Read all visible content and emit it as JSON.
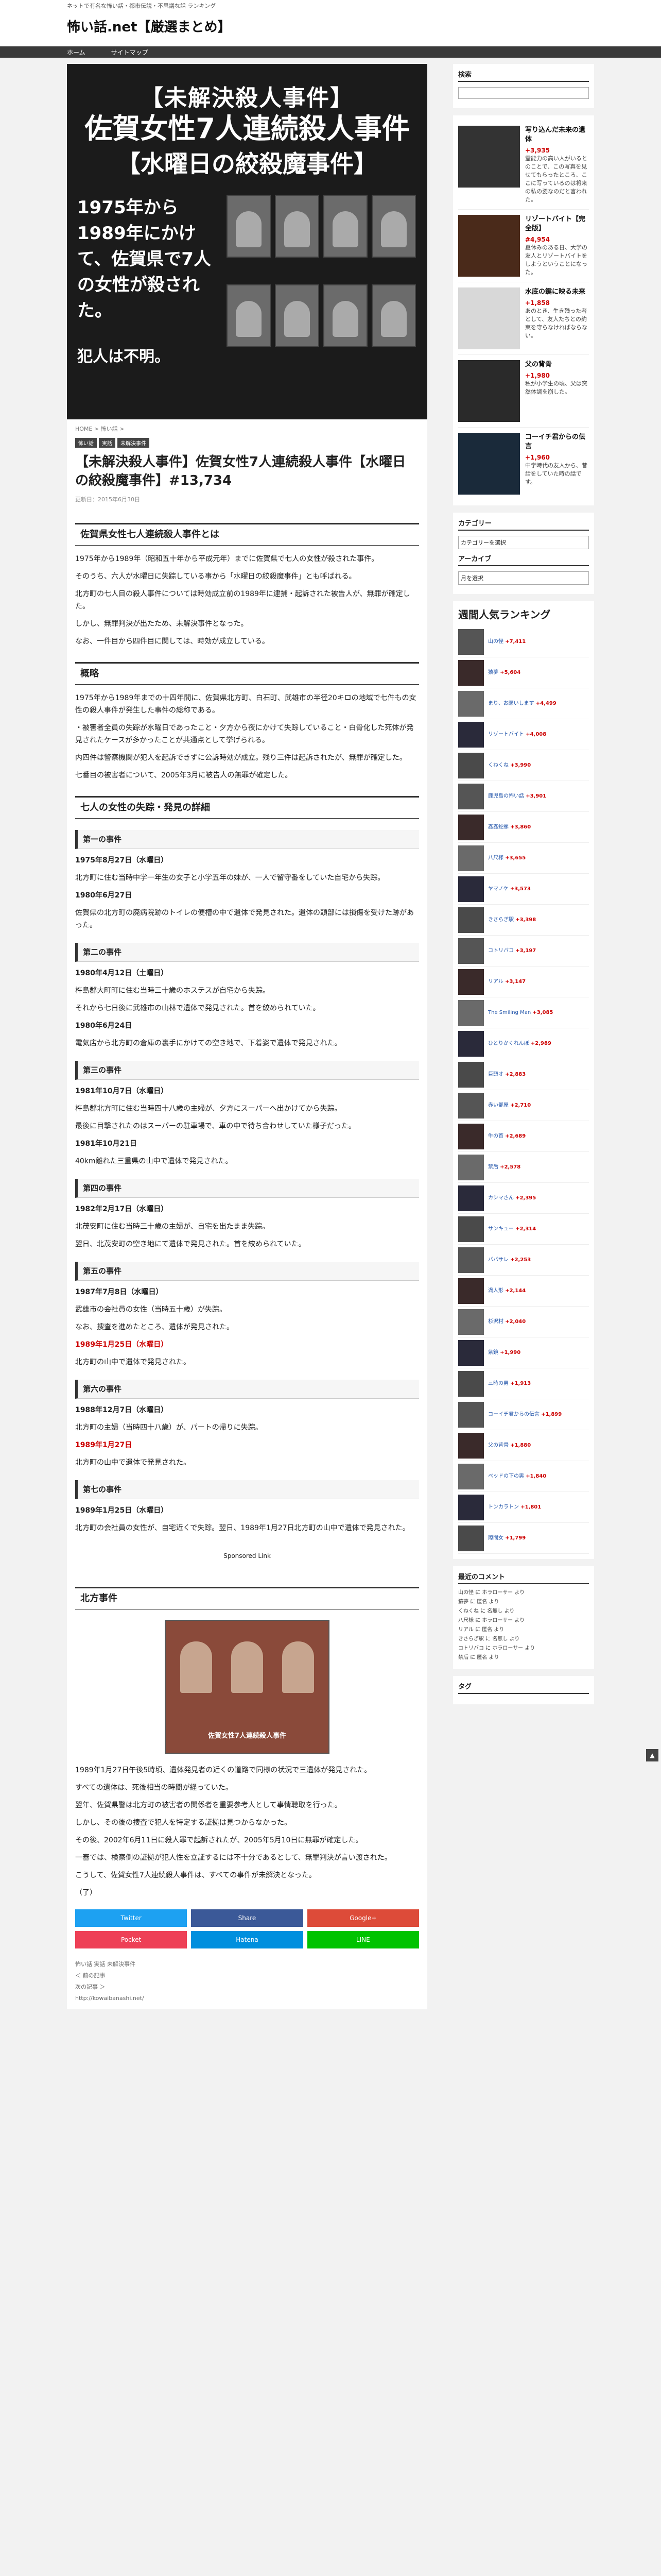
{
  "site": {
    "tagline": "ネットで有名な怖い話・都市伝説・不思議な話 ランキング",
    "title": "怖い話.net【厳選まとめ】"
  },
  "nav": {
    "home": "ホーム",
    "sitemap": "サイトマップ"
  },
  "hero": {
    "line1": "【未解決殺人事件】",
    "line2": "佐賀女性7人連続殺人事件",
    "line3": "【水曜日の絞殺魔事件】",
    "text1": "1975年から1989年にかけて、佐賀県で7人の女性が殺された。",
    "text2": "犯人は不明。"
  },
  "breadcrumb": "HOME > 怖い話 >",
  "tags": [
    "怖い話",
    "実話",
    "未解決事件"
  ],
  "post": {
    "title": "【未解決殺人事件】佐賀女性7人連続殺人事件【水曜日の絞殺魔事件】#13,734",
    "date": "更新日：2015年6月30日"
  },
  "sections": {
    "s1": "佐賀県女性七人連続殺人事件とは",
    "s1p1": "1975年から1989年（昭和五十年から平成元年）までに佐賀県で七人の女性が殺された事件。",
    "s1p2": "そのうち、六人が水曜日に失踪している事から「水曜日の絞殺魔事件」とも呼ばれる。",
    "s1p3": "北方町の七人目の殺人事件については時効成立前の1989年に逮捕・起訴された被告人が、無罪が確定した。",
    "s1p4": "しかし、無罪判決が出たため、未解決事件となった。",
    "s1p5": "なお、一件目から四件目に関しては、時効が成立している。",
    "s2": "概略",
    "s2p1": "1975年から1989年までの十四年間に、佐賀県北方町、白石町、武雄市の半径20キロの地域で七件もの女性の殺人事件が発生した事件の総称である。",
    "s2p2": "・被害者全員の失踪が水曜日であったこと・夕方から夜にかけて失踪していること・白骨化した死体が発見されたケースが多かったことが共通点として挙げられる。",
    "s2p3": "内四件は警察機関が犯人を起訴できずに公訴時効が成立。残り三件は起訴されたが、無罪が確定した。",
    "s2p4": "七番目の被害者について、2005年3月に被告人の無罪が確定した。",
    "s3": "七人の女性の失踪・発見の詳細",
    "c1": "第一の事件",
    "c1d1": "1975年8月27日（水曜日）",
    "c1p1": "北方町に住む当時中学一年生の女子と小学五年の妹が、一人で留守番をしていた自宅から失踪。",
    "c1d2": "1980年6月27日",
    "c1p2": "佐賀県の北方町の廃病院跡のトイレの便槽の中で遺体で発見された。遺体の頭部には損傷を受けた跡があった。",
    "c2": "第二の事件",
    "c2d1": "1980年4月12日（土曜日）",
    "c2p1": "杵島郡大町町に住む当時三十歳のホステスが自宅から失踪。",
    "c2p2": "それから七日後に武雄市の山林で遺体で発見された。首を絞められていた。",
    "c2d2": "1980年6月24日",
    "c2p3": "電気店から北方町の倉庫の裏手にかけての空き地で、下着姿で遺体で発見された。",
    "c3": "第三の事件",
    "c3d1": "1981年10月7日（水曜日）",
    "c3p1": "杵島郡北方町に住む当時四十八歳の主婦が、夕方にスーパーへ出かけてから失踪。",
    "c3p2": "最後に目撃されたのはスーパーの駐車場で、車の中で待ち合わせしていた様子だった。",
    "c3d2": "1981年10月21日",
    "c3p3": "40km離れた三重県の山中で遺体で発見された。",
    "c4": "第四の事件",
    "c4d1": "1982年2月17日（水曜日）",
    "c4p1": "北茂安町に住む当時三十歳の主婦が、自宅を出たまま失踪。",
    "c4p2": "翌日、北茂安町の空き地にて遺体で発見された。首を絞められていた。",
    "c5": "第五の事件",
    "c5d1": "1987年7月8日（水曜日）",
    "c5p1": "武雄市の会社員の女性（当時五十歳）が失踪。",
    "c5p2": "なお、捜査を進めたところ、遺体が発見された。",
    "c5d2": "1989年1月25日（水曜日）",
    "c5p3": "北方町の山中で遺体で発見された。",
    "c6": "第六の事件",
    "c6d1": "1988年12月7日（水曜日）",
    "c6p1": "北方町の主婦（当時四十八歳）が、パートの帰りに失踪。",
    "c6d2": "1989年1月27日",
    "c6p2": "北方町の山中で遺体で発見された。",
    "c7": "第七の事件",
    "c7d1": "1989年1月25日（水曜日）",
    "c7p1": "北方町の会社員の女性が、自宅近くで失踪。翌日、1989年1月27日北方町の山中で遺体で発見された。",
    "spons": "Sponsored Link",
    "s4": "北方事件",
    "photo_caption": "佐賀女性7人連続殺人事件",
    "s4p1": "1989年1月27日午後5時頃、遺体発見者の近くの道路で同様の状況で三遺体が発見された。",
    "s4p2": "すべての遺体は、死後相当の時間が経っていた。",
    "s4p3": "翌年、佐賀県警は北方町の被害者の関係者を重要参考人として事情聴取を行った。",
    "s4p4": "しかし、その後の捜査で犯人を特定する証拠は見つからなかった。",
    "s4p5": "その後、2002年6月11日に殺人罪で起訴されたが、2005年5月10日に無罪が確定した。",
    "s4p6": "一審では、検察側の証拠が犯人性を立証するには不十分であるとして、無罪判決が言い渡された。",
    "s4p7": "こうして、佐賀女性7人連続殺人事件は、すべての事件が未解決となった。",
    "s4p8": "（了）"
  },
  "share": {
    "twitter": "Twitter",
    "facebook": "Share",
    "google": "Google+",
    "pocket": "Pocket",
    "hatena": "Hatena",
    "line": "LINE"
  },
  "foot": {
    "cat": "怖い話 実話 未解決事件",
    "prev": "＜ 前の記事",
    "next": "次の記事 ＞",
    "url": "http://kowaibanashi.net/"
  },
  "sidebar": {
    "search": "検索",
    "articles": [
      {
        "title": "写り込んだ未来の遺体",
        "count": "+3,935",
        "desc": "霊能力の高い人がいるとのことで、この写真を見せてもらったところ、ここに写っているのは将来の私の姿なのだと言われた。"
      },
      {
        "title": "リゾートバイト【完全版】",
        "count": "#4,954",
        "desc": "夏休みのある日、大学の友人とリゾートバイトをしようということになった。"
      },
      {
        "title": "水底の鍵に映る未来",
        "count": "+1,858",
        "desc": "あのとき、生き残った者として、友人たちとの約束を守らなければならない。"
      },
      {
        "title": "父の背骨",
        "count": "+1,980",
        "desc": "私が小学生の頃、父は突然体調を崩した。"
      },
      {
        "title": "コーイチ君からの伝言",
        "count": "+1,960",
        "desc": "中学時代の友人から、昔話をしていた時の話です。"
      }
    ],
    "category": "カテゴリー",
    "category_sel": "カテゴリーを選択",
    "archive": "アーカイブ",
    "archive_sel": "月を選択",
    "rank_title": "週間人気ランキング",
    "ranking": [
      {
        "t": "山の怪",
        "c": "+7,411"
      },
      {
        "t": "猿夢",
        "c": "+5,604"
      },
      {
        "t": "まり、お願いします",
        "c": "+4,499"
      },
      {
        "t": "リゾートバイト",
        "c": "+4,008"
      },
      {
        "t": "くねくね",
        "c": "+3,990"
      },
      {
        "t": "鹿児島の怖い話",
        "c": "+3,901"
      },
      {
        "t": "姦姦蛇螺",
        "c": "+3,860"
      },
      {
        "t": "八尺様",
        "c": "+3,655"
      },
      {
        "t": "ヤマノケ",
        "c": "+3,573"
      },
      {
        "t": "きさらぎ駅",
        "c": "+3,398"
      },
      {
        "t": "コトリバコ",
        "c": "+3,197"
      },
      {
        "t": "リアル",
        "c": "+3,147"
      },
      {
        "t": "The Smiling Man",
        "c": "+3,085"
      },
      {
        "t": "ひとりかくれんぼ",
        "c": "+2,989"
      },
      {
        "t": "巨頭オ",
        "c": "+2,883"
      },
      {
        "t": "赤い部屋",
        "c": "+2,710"
      },
      {
        "t": "牛の首",
        "c": "+2,689"
      },
      {
        "t": "禁后",
        "c": "+2,578"
      },
      {
        "t": "カシマさん",
        "c": "+2,395"
      },
      {
        "t": "サンキュー",
        "c": "+2,314"
      },
      {
        "t": "ババサレ",
        "c": "+2,253"
      },
      {
        "t": "渦人形",
        "c": "+2,144"
      },
      {
        "t": "杉沢村",
        "c": "+2,040"
      },
      {
        "t": "紫鏡",
        "c": "+1,990"
      },
      {
        "t": "三時の男",
        "c": "+1,913"
      },
      {
        "t": "コーイチ君からの伝言",
        "c": "+1,899"
      },
      {
        "t": "父の背骨",
        "c": "+1,880"
      },
      {
        "t": "ベッドの下の男",
        "c": "+1,840"
      },
      {
        "t": "トンカラトン",
        "c": "+1,801"
      },
      {
        "t": "隙間女",
        "c": "+1,799"
      }
    ],
    "comments_title": "最近のコメント",
    "comments": [
      "山の怪 に ホラローサー より",
      "猿夢 に 匿名 より",
      "くねくね に 名無し より",
      "八尺様 に ホラローサー より",
      "リアル に 匿名 より",
      "きさらぎ駅 に 名無し より",
      "コトリバコ に ホラローサー より",
      "禁后 に 匿名 より"
    ],
    "tag_title": "タグ"
  }
}
